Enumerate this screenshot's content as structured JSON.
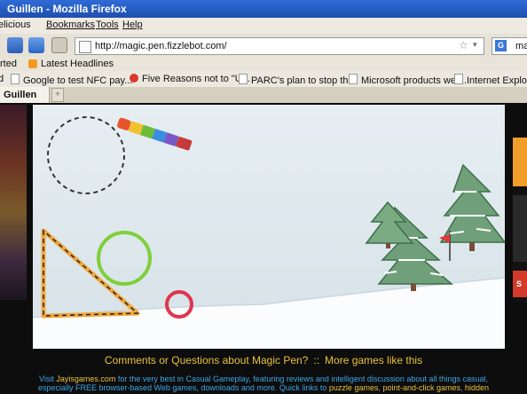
{
  "window": {
    "title": "Guillen - Mozilla Firefox"
  },
  "menu": [
    "elicious",
    "Bookmarks",
    "Tools",
    "Help"
  ],
  "nav": {
    "url": "http://magic.pen.fizzlebot.com/",
    "search_text": "mag",
    "search_engine": "G"
  },
  "bookmarks_top": [
    "rted",
    "Latest Headlines"
  ],
  "bookmarks": [
    "d",
    "Google to test NFC pay...",
    "Five Reasons not to \"U...",
    "PARC's plan to stop th...",
    "Microsoft products we ...",
    "Internet Explore"
  ],
  "tab": {
    "label": "Guillen",
    "new_tab": "+"
  },
  "right_ad": {
    "label": "S"
  },
  "footer": {
    "line1_a": "Comments or Questions about Magic Pen?",
    "line1_sep": "::",
    "line1_b": "More games like this",
    "line2_a": "Visit ",
    "line2_site": "Jayisgames.com",
    "line2_b": " for the very best in Casual Gameplay, featuring reviews and intelligent discussion about all things casual,",
    "line3_a": "especially FREE browser-based Web games, downloads and more. Quick links to ",
    "line3_l1": "puzzle games",
    "line3_sep1": ", ",
    "line3_l2": "point-and-click games",
    "line3_sep2": ", ",
    "line3_l3": "hidden"
  },
  "colors": {
    "titlebar": "#2f6bd6",
    "footer_link": "#e8c33c",
    "footer_text": "#3aa8e8",
    "circle_green": "#7fcf3a",
    "circle_red": "#e0354f",
    "triangle_orange": "#f2a83a"
  },
  "icons": [
    "back-icon",
    "forward-icon",
    "home-icon",
    "page-icon",
    "star-icon",
    "rss-icon",
    "crayon-icon"
  ]
}
